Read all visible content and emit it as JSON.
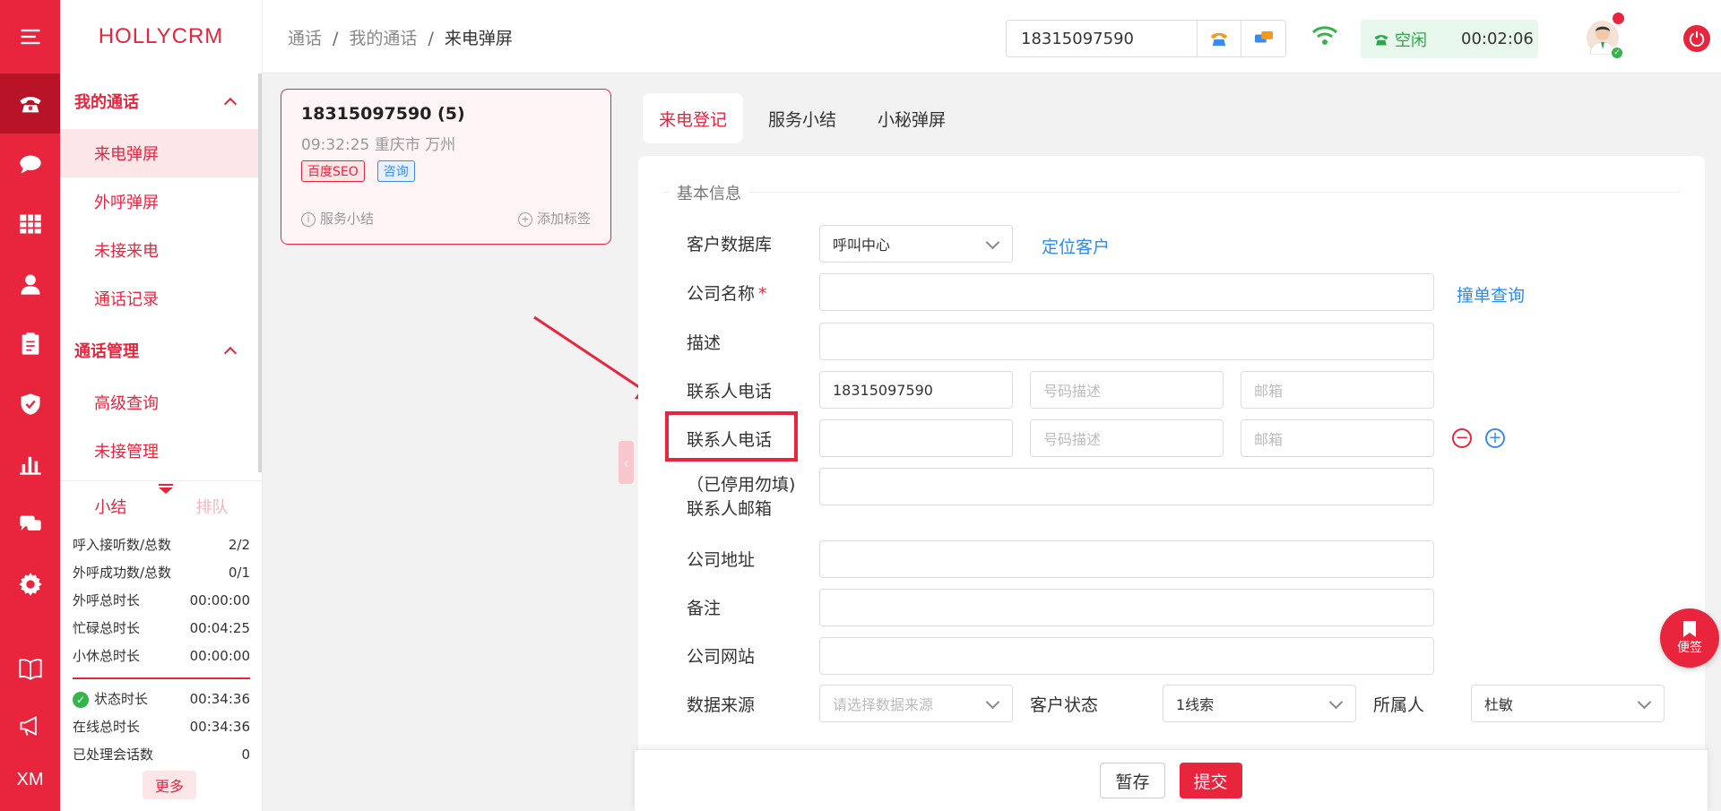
{
  "app": {
    "brand": "HOLLYCRM"
  },
  "rail": {
    "icons": [
      "menu-icon",
      "phone-icon",
      "chat-icon",
      "grid-icon",
      "user-icon",
      "clipboard-icon",
      "shield-icon",
      "bar-chart-icon",
      "message-icon",
      "gear-icon",
      "book-icon",
      "megaphone-icon"
    ],
    "xm_label": "XM"
  },
  "sidebar": {
    "group1": "我的通话",
    "group1_items": [
      "来电弹屏",
      "外呼弹屏",
      "未接来电",
      "通话记录"
    ],
    "group2": "通话管理",
    "group2_items": [
      "高级查询",
      "未接管理"
    ]
  },
  "stats": {
    "tab_summary": "小结",
    "tab_queue": "排队",
    "rows": [
      {
        "label": "呼入接听数/总数",
        "value": "2/2"
      },
      {
        "label": "外呼成功数/总数",
        "value": "0/1"
      },
      {
        "label": "外呼总时长",
        "value": "00:00:00"
      },
      {
        "label": "忙碌总时长",
        "value": "00:04:25"
      },
      {
        "label": "小休总时长",
        "value": "00:00:00"
      }
    ],
    "rows2": [
      {
        "label": "状态时长",
        "value": "00:34:36"
      },
      {
        "label": "在线总时长",
        "value": "00:34:36"
      },
      {
        "label": "已处理会话数",
        "value": "0"
      }
    ],
    "more": "更多"
  },
  "header": {
    "breadcrumb": [
      "通话",
      "我的通话",
      "来电弹屏"
    ],
    "phone": "18315097590",
    "status": "空闲",
    "timer": "00:02:06"
  },
  "call_card": {
    "number": "18315097590 (5)",
    "meta": "09:32:25 重庆市 万州",
    "tags": [
      "百度SEO",
      "咨询"
    ],
    "action_summary": "服务小结",
    "action_tag": "添加标签"
  },
  "main_tabs": [
    "来电登记",
    "服务小结",
    "小秘弹屏"
  ],
  "form": {
    "section": "基本信息",
    "customer_db_label": "客户数据库",
    "customer_db_value": "呼叫中心",
    "locate_link": "定位客户",
    "company_label": "公司名称",
    "company_required": "*",
    "dup_link": "撞单查询",
    "desc_label": "描述",
    "contact_phone_label": "联系人电话",
    "contact_phone_value": "18315097590",
    "phone_desc_ph": "号码描述",
    "email_ph": "邮箱",
    "contact_phone_label2": "联系人电话",
    "email_label_line1": "（已停用勿填)",
    "email_label_line2": "联系人邮箱",
    "address_label": "公司地址",
    "remark_label": "备注",
    "website_label": "公司网站",
    "source_label": "数据来源",
    "source_ph": "请选择数据来源",
    "cust_status_label": "客户状态",
    "cust_status_value": "1线索",
    "owner_label": "所属人",
    "owner_value": "杜敏"
  },
  "footer": {
    "save": "暂存",
    "submit": "提交"
  },
  "sticky": {
    "label": "便签"
  },
  "colors": {
    "brand": "#e8253c",
    "link": "#2a8de8",
    "idle": "#2aa84a"
  }
}
